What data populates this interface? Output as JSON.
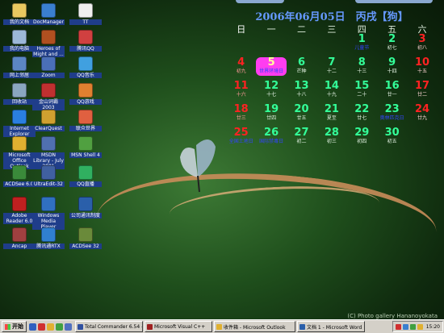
{
  "desktop_icons": [
    {
      "label": "我的文档",
      "color": "#e9c960"
    },
    {
      "label": "DocManager",
      "color": "#3a7fd0"
    },
    {
      "label": "TT",
      "color": "#f0f0f0"
    },
    {
      "label": "我的电脑",
      "color": "#9cb8d8"
    },
    {
      "label": "Heroes of Might and ...",
      "color": "#b05020"
    },
    {
      "label": "腾讯QQ",
      "color": "#d04040"
    },
    {
      "label": "网上邻居",
      "color": "#5b86c4"
    },
    {
      "label": "Zoom",
      "color": "#4a6fb8"
    },
    {
      "label": "QQ音乐",
      "color": "#40a0e0"
    },
    {
      "label": "回收站",
      "color": "#8aa6c0"
    },
    {
      "label": "金山词霸2003",
      "color": "#c03030"
    },
    {
      "label": "QQ游戏",
      "color": "#e08030"
    },
    {
      "label": "Internet Explorer",
      "color": "#2a7fe0"
    },
    {
      "label": "ClearQuest",
      "color": "#d0a030"
    },
    {
      "label": "联众世界",
      "color": "#e06040"
    },
    {
      "label": "Microsoft Office Outlook",
      "color": "#e0b030"
    },
    {
      "label": "MSDN Library - July 2001",
      "color": "#5070b0"
    },
    {
      "label": "MSN Shell 4",
      "color": "#50a040"
    },
    {
      "label": "ACDSee 6.0",
      "color": "#3a8a3a"
    },
    {
      "label": "UltraEdit-32",
      "color": "#4060a0"
    },
    {
      "label": "QQ直播",
      "color": "#30b060"
    },
    {
      "label": "Adobe Reader 6.0",
      "color": "#c02020"
    },
    {
      "label": "Windows Media Player",
      "color": "#3070c0"
    },
    {
      "label": "公司通讯制度",
      "color": "#2a5faa"
    },
    {
      "label": "Ancap",
      "color": "#a04040"
    },
    {
      "label": "腾讯通RTX",
      "color": "#3080d0"
    },
    {
      "label": "ACDSee 32",
      "color": "#6a8a3a"
    }
  ],
  "calendar": {
    "header": "2006年06月05日　丙戌【狗】",
    "weekdays": [
      "日",
      "一",
      "二",
      "三",
      "四",
      "五",
      "六"
    ],
    "weeks": [
      [
        null,
        null,
        null,
        null,
        {
          "d": "1",
          "s": "儿童节",
          "k": "blue"
        },
        {
          "d": "2",
          "s": "初七",
          "k": "w"
        },
        {
          "d": "3",
          "s": "初八",
          "k": "sat"
        }
      ],
      [
        {
          "d": "4",
          "s": "初九",
          "k": "sun"
        },
        {
          "d": "5",
          "s": "世界环境日",
          "k": "today"
        },
        {
          "d": "6",
          "s": "芒种",
          "k": "w"
        },
        {
          "d": "7",
          "s": "十二",
          "k": "w"
        },
        {
          "d": "8",
          "s": "十三",
          "k": "w"
        },
        {
          "d": "9",
          "s": "十四",
          "k": "w"
        },
        {
          "d": "10",
          "s": "十五",
          "k": "sat"
        }
      ],
      [
        {
          "d": "11",
          "s": "十六",
          "k": "sun"
        },
        {
          "d": "12",
          "s": "十七",
          "k": "w"
        },
        {
          "d": "13",
          "s": "十八",
          "k": "w"
        },
        {
          "d": "14",
          "s": "十九",
          "k": "w"
        },
        {
          "d": "15",
          "s": "二十",
          "k": "w"
        },
        {
          "d": "16",
          "s": "廿一",
          "k": "w"
        },
        {
          "d": "17",
          "s": "廿二",
          "k": "sat"
        }
      ],
      [
        {
          "d": "18",
          "s": "廿三",
          "k": "sun"
        },
        {
          "d": "19",
          "s": "廿四",
          "k": "w"
        },
        {
          "d": "20",
          "s": "廿五",
          "k": "w"
        },
        {
          "d": "21",
          "s": "夏至",
          "k": "w"
        },
        {
          "d": "22",
          "s": "廿七",
          "k": "w"
        },
        {
          "d": "23",
          "s": "奥林匹克日",
          "k": "blue"
        },
        {
          "d": "24",
          "s": "廿九",
          "k": "sat"
        }
      ],
      [
        {
          "d": "25",
          "s": "全国土地日",
          "k": "sun-blue"
        },
        {
          "d": "26",
          "s": "国际禁毒日",
          "k": "blue"
        },
        {
          "d": "27",
          "s": "初二",
          "k": "w"
        },
        {
          "d": "28",
          "s": "初三",
          "k": "w"
        },
        {
          "d": "29",
          "s": "初四",
          "k": "w"
        },
        {
          "d": "30",
          "s": "初五",
          "k": "w"
        },
        null
      ]
    ]
  },
  "credit": "(C) Photo gallery Hananoyokata",
  "taskbar": {
    "start_label": "开始",
    "tasks": [
      {
        "label": "Total Commander 6.54 -...",
        "color": "#3050a0"
      },
      {
        "label": "Microsoft Visual C++",
        "color": "#a02020"
      },
      {
        "label": "收件箱 - Microsoft Outlook",
        "color": "#e0b030"
      },
      {
        "label": "文档 1 - Microsoft Word",
        "color": "#2a5faa"
      }
    ],
    "clock": "15:20"
  }
}
